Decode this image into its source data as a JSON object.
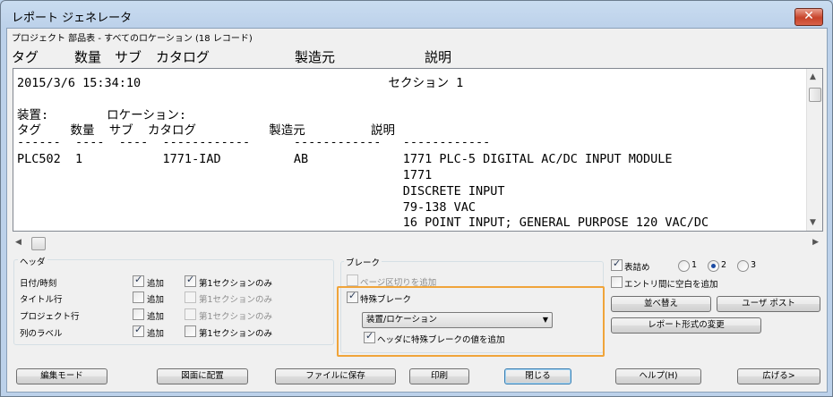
{
  "window": {
    "title": "レポート ジェネレータ",
    "close_glyph": "✕"
  },
  "subtitle": "プロジェクト 部品表 - すべてのロケーション (18 レコード)",
  "columns": [
    "タグ",
    "数量",
    "サブ",
    "カタログ",
    "製造元",
    "説明"
  ],
  "report": {
    "lines": [
      "2015/3/6 15:34:10                                  セクション 1",
      "",
      "装置:        ロケーション:",
      "タグ    数量  サブ  カタログ          製造元         説明",
      "------  ----  ----  ------------      ------------   ------------",
      "",
      "PLC502  1           1771-IAD          AB             1771 PLC-5 DIGITAL AC/DC INPUT MODULE",
      "                                                     1771",
      "                                                     DISCRETE INPUT",
      "                                                     79-138 VAC",
      "                                                     16 POINT INPUT; GENERAL PURPOSE 120 VAC/DC"
    ]
  },
  "scroll": {
    "up": "▲",
    "down": "▼",
    "left": "◀",
    "right": "▶"
  },
  "header_group": {
    "label": "ヘッダ",
    "rows": [
      {
        "label": "日付/時刻",
        "add_label": "追加",
        "add_checked": true,
        "first_label": "第1セクションのみ",
        "first_checked": true,
        "first_enabled": true
      },
      {
        "label": "タイトル行",
        "add_label": "追加",
        "add_checked": false,
        "first_label": "第1セクションのみ",
        "first_checked": false,
        "first_enabled": false
      },
      {
        "label": "プロジェクト行",
        "add_label": "追加",
        "add_checked": false,
        "first_label": "第1セクションのみ",
        "first_checked": false,
        "first_enabled": false
      },
      {
        "label": "列のラベル",
        "add_label": "追加",
        "add_checked": true,
        "first_label": "第1セクションのみ",
        "first_checked": false,
        "first_enabled": true
      }
    ]
  },
  "break_group": {
    "label": "ブレーク",
    "page_break_label": "ページ区切りを追加",
    "page_break_checked": false,
    "page_break_enabled": false,
    "special_label": "特殊ブレーク",
    "special_checked": true,
    "select_value": "装置/ロケーション",
    "add_header_label": "ヘッダに特殊ブレークの値を追加",
    "add_header_checked": true
  },
  "right_panel": {
    "compact_label": "表詰め",
    "compact_checked": true,
    "radio_options": [
      "1",
      "2",
      "3"
    ],
    "radio_selected": "2",
    "blank_label": "エントリ間に空白を追加",
    "blank_checked": false,
    "sort_button": "並べ替え",
    "user_post_button": "ユーザ ポスト",
    "format_button": "レポート形式の変更"
  },
  "bottom_buttons": {
    "edit_mode": "編集モード",
    "place_in_drawing": "図面に配置",
    "save_to_file": "ファイルに保存",
    "print": "印刷",
    "close": "閉じる",
    "help": "ヘルプ(H)",
    "expand": "広げる>"
  },
  "colors": {
    "highlight": "#f0a43a",
    "accent": "#1b4aa3"
  }
}
